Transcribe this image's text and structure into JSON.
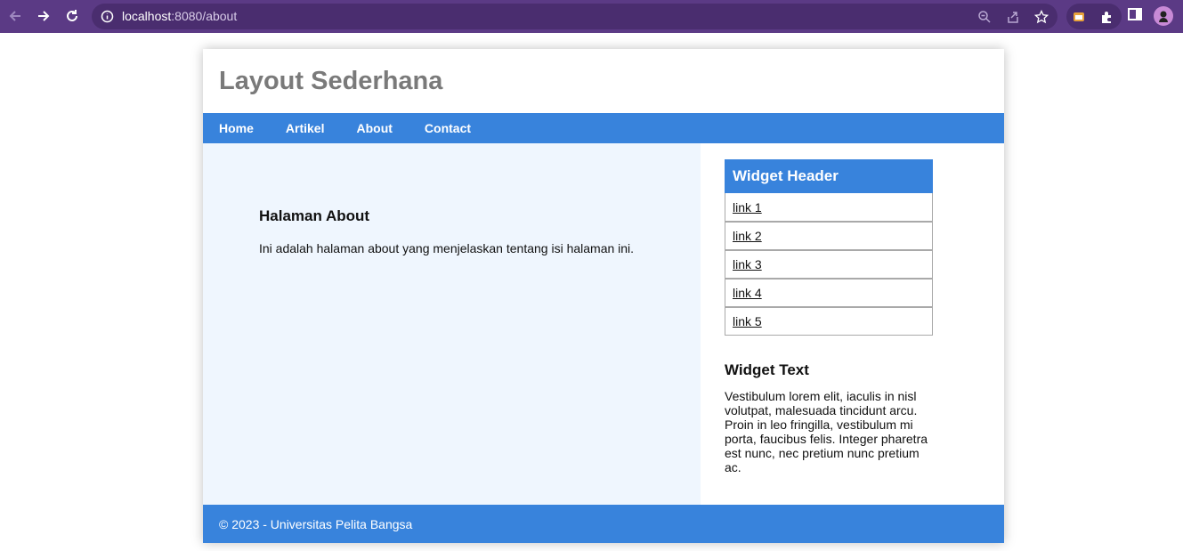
{
  "browser": {
    "url_host": "localhost",
    "url_rest": ":8080/about"
  },
  "site": {
    "title": "Layout Sederhana",
    "nav": [
      "Home",
      "Artikel",
      "About",
      "Contact"
    ]
  },
  "main": {
    "heading": "Halaman About",
    "text": "Ini adalah halaman about yang menjelaskan tentang isi halaman ini."
  },
  "sidebar": {
    "widget_header": "Widget Header",
    "links": [
      "link 1",
      "link 2",
      "link 3",
      "link 4",
      "link 5"
    ],
    "text_heading": "Widget Text",
    "text_body": "Vestibulum lorem elit, iaculis in nisl volutpat, malesuada tincidunt arcu. Proin in leo fringilla, vestibulum mi porta, faucibus felis. Integer pharetra est nunc, nec pretium nunc pretium ac."
  },
  "footer": {
    "text": "© 2023 - Universitas Pelita Bangsa"
  },
  "colors": {
    "chrome": "#5b3a85",
    "accent": "#3883dc",
    "main_bg": "#eff6fe",
    "title_gray": "#7a7a7a"
  }
}
